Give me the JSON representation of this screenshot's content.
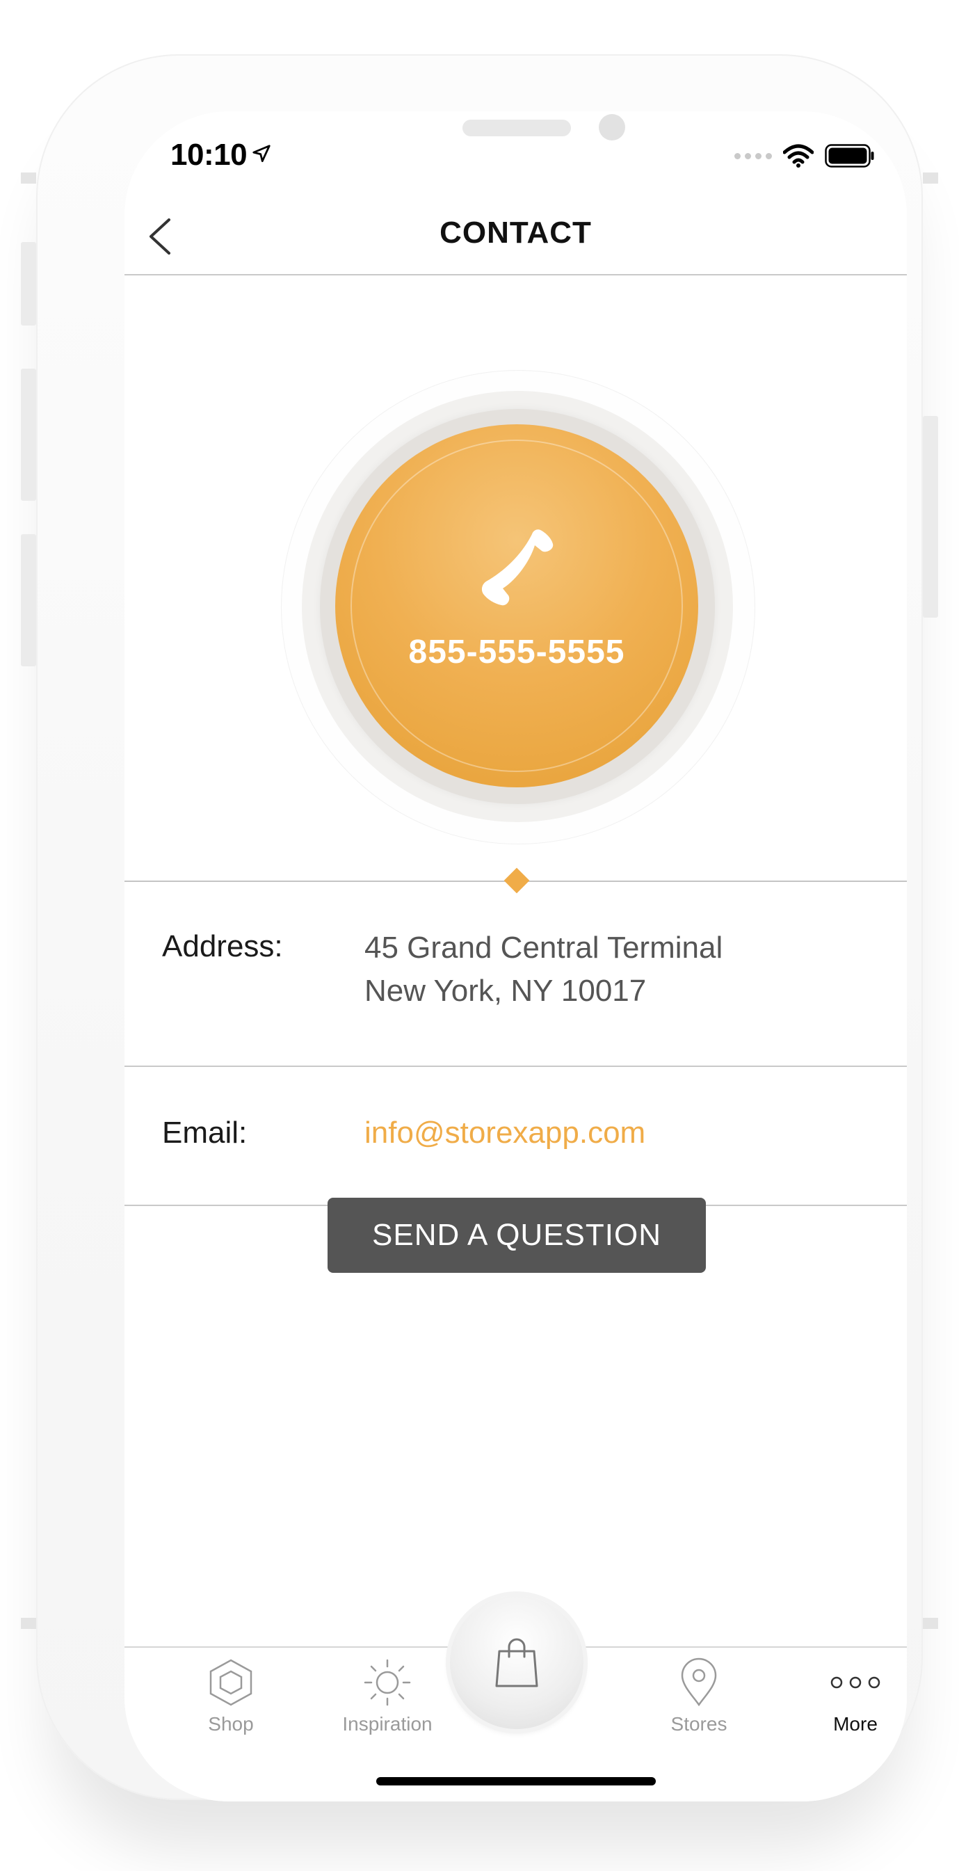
{
  "status_bar": {
    "time": "10:10",
    "location_icon": "location-arrow-icon",
    "signal_icon": "signal-dots-icon",
    "wifi_icon": "wifi-icon",
    "battery_icon": "battery-icon"
  },
  "nav": {
    "title": "CONTACT",
    "back_icon": "chevron-left-icon"
  },
  "call": {
    "phone_icon": "phone-icon",
    "phone_number": "855-555-5555"
  },
  "address": {
    "label": "Address:",
    "line1": "45 Grand Central Terminal",
    "line2": "New York, NY 10017"
  },
  "email": {
    "label": "Email:",
    "value": "info@storexapp.com"
  },
  "send_button": {
    "label": "SEND A QUESTION"
  },
  "tab_bar": {
    "tabs": [
      {
        "label": "Shop",
        "icon": "hexagon-icon",
        "active": false
      },
      {
        "label": "Inspiration",
        "icon": "sun-icon",
        "active": false
      },
      {
        "label": "Stores",
        "icon": "map-pin-icon",
        "active": false
      },
      {
        "label": "More",
        "icon": "more-dots-icon",
        "active": true
      }
    ],
    "cart_icon": "shopping-bag-icon"
  },
  "colors": {
    "accent": "#f0ac48",
    "button_dark": "#555555",
    "text_primary": "#1a1a1a",
    "text_secondary": "#555555",
    "tab_inactive": "#9a9a9a"
  }
}
